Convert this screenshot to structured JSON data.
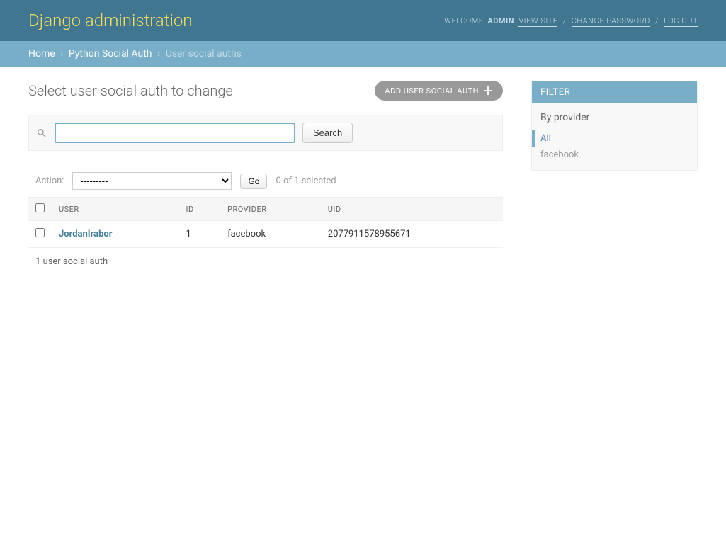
{
  "header": {
    "branding": "Django administration",
    "welcome": "WELCOME,",
    "username": "ADMIN",
    "view_site": "VIEW SITE",
    "change_password": "CHANGE PASSWORD",
    "log_out": "LOG OUT"
  },
  "breadcrumbs": {
    "home": "Home",
    "app": "Python Social Auth",
    "current": "User social auths"
  },
  "page": {
    "title": "Select user social auth to change",
    "add_label": "ADD USER SOCIAL AUTH"
  },
  "search": {
    "button": "Search",
    "value": ""
  },
  "actions": {
    "label": "Action:",
    "placeholder": "---------",
    "go": "Go",
    "counter": "0 of 1 selected"
  },
  "table": {
    "headers": {
      "user": "USER",
      "id": "ID",
      "provider": "PROVIDER",
      "uid": "UID"
    },
    "rows": [
      {
        "user": "JordanIrabor",
        "id": "1",
        "provider": "facebook",
        "uid": "2077911578955671"
      }
    ],
    "paginator": "1 user social auth"
  },
  "filter": {
    "title": "FILTER",
    "group_label": "By provider",
    "options": [
      {
        "label": "All",
        "selected": true
      },
      {
        "label": "facebook",
        "selected": false
      }
    ]
  }
}
